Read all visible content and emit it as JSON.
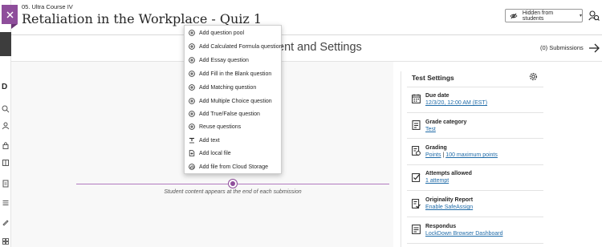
{
  "header": {
    "course_name": "05. Ultra Course IV",
    "title": "Retaliation in the Workplace - Quiz 1",
    "visibility": "Hidden from students"
  },
  "subheader": {
    "title": "ent and Settings",
    "submissions": "(0) Submissions"
  },
  "left_strip": {
    "letter": "D"
  },
  "canvas": {
    "note": "Student content appears at the end of each submission",
    "mark1": "V",
    "mark2": "/"
  },
  "menu": {
    "items": [
      {
        "label": "Add question pool",
        "icon": "plus-circle-icon"
      },
      {
        "label": "Add Calculated Formula question",
        "icon": "plus-circle-icon"
      },
      {
        "label": "Add Essay question",
        "icon": "plus-circle-icon"
      },
      {
        "label": "Add Fill in the Blank question",
        "icon": "plus-circle-icon"
      },
      {
        "label": "Add Matching question",
        "icon": "plus-circle-icon"
      },
      {
        "label": "Add Multiple Choice question",
        "icon": "plus-circle-icon"
      },
      {
        "label": "Add True/False question",
        "icon": "plus-circle-icon"
      },
      {
        "label": "Reuse questions",
        "icon": "plus-circle-icon"
      },
      {
        "label": "Add text",
        "icon": "text-icon"
      },
      {
        "label": "Add local file",
        "icon": "file-upload-icon"
      },
      {
        "label": "Add file from Cloud Storage",
        "icon": "cloud-icon"
      }
    ]
  },
  "settings": {
    "title": "Test Settings",
    "items": [
      {
        "label": "Due date",
        "value": "12/3/20, 12:00 AM (EST)",
        "icon": "calendar-icon"
      },
      {
        "label": "Grade category",
        "value": "Test",
        "icon": "grade-category-icon"
      },
      {
        "label": "Grading",
        "value": "Points",
        "value2": "100 maximum points",
        "separator": "|",
        "icon": "grading-icon"
      },
      {
        "label": "Attempts allowed",
        "value": "1 attempt",
        "icon": "attempts-icon"
      },
      {
        "label": "Originality Report",
        "value": "Enable SafeAssign",
        "icon": "originality-icon"
      },
      {
        "label": "Respondus",
        "value": "LockDown Browser Dashboard",
        "icon": "respondus-icon"
      }
    ]
  },
  "colors": {
    "accent": "#8e4e9b",
    "link": "#1f6ba8",
    "text": "#262626"
  }
}
